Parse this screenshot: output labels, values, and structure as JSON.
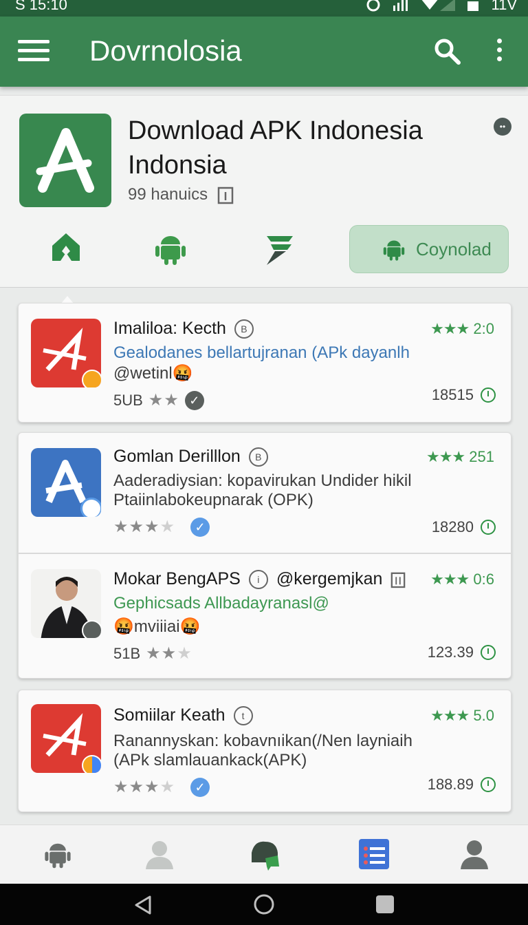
{
  "status_bar": {
    "time": "S 15:10",
    "right_text": "11V"
  },
  "appbar": {
    "title": "Dovrnolosia"
  },
  "header": {
    "title_line1": "Download APK Indonesia",
    "title_line2": "Indonsia",
    "subtitle": "99 hanuics",
    "download_button": "Coynolad"
  },
  "apps": [
    {
      "name": "Imaliloa: Kecth",
      "badge": "B",
      "desc_line1": "Gealodanes bellartujranan (APk dayanlh",
      "desc_line2": "@wetinl🤬",
      "meta_prefix": "5UB",
      "rating_stars": "★★★",
      "rating_value": "2:0",
      "count": "18515",
      "stars_on": 2,
      "stars_total": 2
    },
    {
      "name": "Gomlan Derilllon",
      "badge": "B",
      "desc_line1": "Aaderadiysian: kopavirukan Undider hikil",
      "desc_line2": "Ptaiinlabokeupnarak (OPK)",
      "meta_prefix": "",
      "rating_stars": "★★★",
      "rating_value": "251",
      "count": "18280",
      "stars_on": 3,
      "stars_total": 4
    },
    {
      "name": "Mokar BengAPS",
      "badge": "i",
      "extra": "@kergemjkan",
      "desc_line1": "Gephicsads Allbadayranasl@",
      "desc_line2": "🤬mviiiai🤬",
      "meta_prefix": "51B",
      "rating_stars": "★★★",
      "rating_value": "0:6",
      "count": "123.39",
      "stars_on": 2,
      "stars_total": 3
    },
    {
      "name": "Somiilar Keath",
      "badge": "t",
      "desc_line1": "Ranannyskan: kobavnıikan(/Nen layniaih",
      "desc_line2": "(APk slamlauankack(APK)",
      "meta_prefix": "",
      "rating_stars": "★★★",
      "rating_value": "5.0",
      "count": "188.89",
      "stars_on": 3,
      "stars_total": 4
    }
  ],
  "colors": {
    "primary": "#3a8552",
    "accent_green": "#3d9850",
    "link_blue": "#3d78b5",
    "app_red": "#dd3a32",
    "app_blue": "#3d74c2"
  }
}
